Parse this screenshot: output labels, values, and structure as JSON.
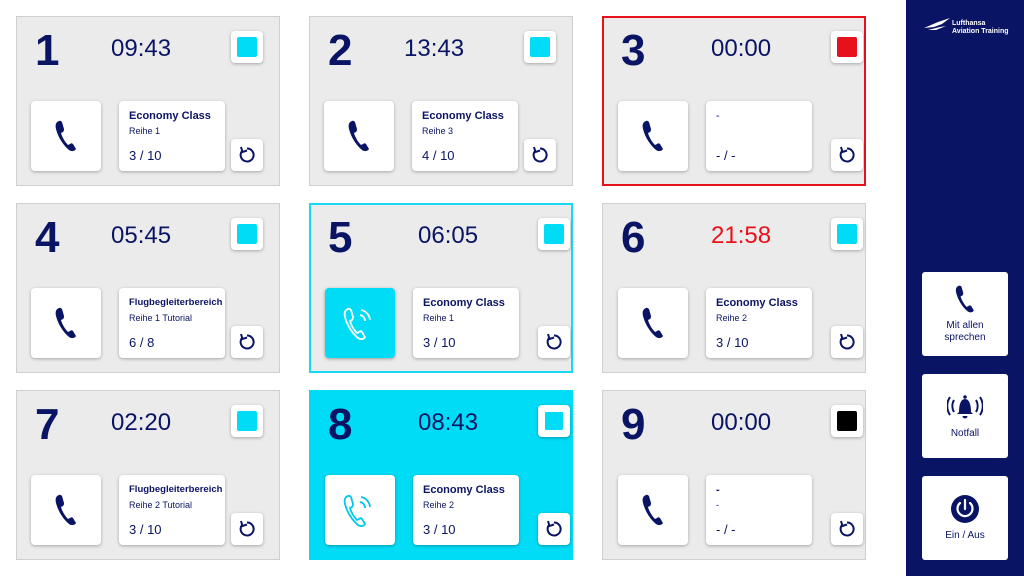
{
  "colors": {
    "navy": "#0a1464",
    "cyan": "#00dcf6",
    "red": "#e8111b",
    "black": "#000000",
    "tile_bg": "#ebebeb"
  },
  "brand": {
    "line1": "Lufthansa",
    "line2": "Aviation Training"
  },
  "seats": [
    {
      "number": "1",
      "time": "09:43",
      "status_color": "#00dcf6",
      "call_active": false,
      "class": "Economy Class",
      "row": "Reihe 1",
      "progress": "3 / 10",
      "time_alert": false
    },
    {
      "number": "2",
      "time": "13:43",
      "status_color": "#00dcf6",
      "call_active": false,
      "class": "Economy Class",
      "row": "Reihe 3",
      "progress": "4 / 10",
      "time_alert": false
    },
    {
      "number": "3",
      "time": "00:00",
      "status_color": "#e8111b",
      "call_active": false,
      "class": "-",
      "row": "",
      "progress": "- / -",
      "time_alert": false
    },
    {
      "number": "4",
      "time": "05:45",
      "status_color": "#00dcf6",
      "call_active": false,
      "class": "Flugbegleiterbereich",
      "row": "Reihe 1 Tutorial",
      "progress": "6 / 8",
      "time_alert": false
    },
    {
      "number": "5",
      "time": "06:05",
      "status_color": "#00dcf6",
      "call_active": true,
      "class": "Economy Class",
      "row": "Reihe 1",
      "progress": "3 / 10",
      "time_alert": false
    },
    {
      "number": "6",
      "time": "21:58",
      "status_color": "#00dcf6",
      "call_active": false,
      "class": "Economy Class",
      "row": "Reihe 2",
      "progress": "3 / 10",
      "time_alert": true
    },
    {
      "number": "7",
      "time": "02:20",
      "status_color": "#00dcf6",
      "call_active": false,
      "class": "Flugbegleiterbereich",
      "row": "Reihe 2 Tutorial",
      "progress": "3 / 10",
      "time_alert": false
    },
    {
      "number": "8",
      "time": "08:43",
      "status_color": "#00dcf6",
      "call_active": true,
      "class": "Economy Class",
      "row": "Reihe 2",
      "progress": "3 / 10",
      "time_alert": false
    },
    {
      "number": "9",
      "time": "00:00",
      "status_color": "#000000",
      "call_active": false,
      "class": "-",
      "row": "-",
      "progress": "- / -",
      "time_alert": false
    }
  ],
  "sidebar": {
    "talk_all": "Mit allen sprechen",
    "emergency": "Notfall",
    "power": "Ein / Aus"
  }
}
